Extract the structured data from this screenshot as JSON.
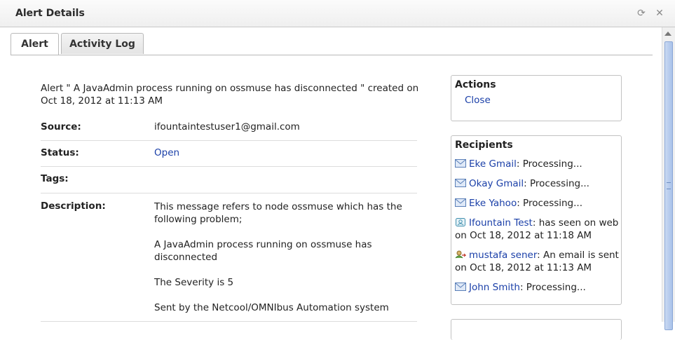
{
  "window": {
    "title": "Alert Details"
  },
  "tabs": [
    {
      "label": "Alert"
    },
    {
      "label": "Activity Log"
    }
  ],
  "alert": {
    "summary": "Alert \" A JavaAdmin process running on ossmuse has disconnected \" created on Oct 18, 2012 at 11:13 AM",
    "source_label": "Source:",
    "source_value": "ifountaintestuser1@gmail.com",
    "status_label": "Status:",
    "status_value": "Open",
    "tags_label": "Tags:",
    "tags_value": "",
    "description_label": "Description:",
    "description_lines": [
      "This message refers to node ossmuse which has the following problem;",
      "A JavaAdmin process running on ossmuse has disconnected",
      "The Severity is 5",
      "Sent by the Netcool/OMNIbus Automation system"
    ]
  },
  "actions": {
    "title": "Actions",
    "items": [
      {
        "label": "Close"
      }
    ]
  },
  "recipients": {
    "title": "Recipients",
    "items": [
      {
        "name": "Eke Gmail",
        "status": ": Processing...",
        "icon": "email-icon"
      },
      {
        "name": "Okay Gmail",
        "status": ": Processing...",
        "icon": "email-icon"
      },
      {
        "name": "Eke Yahoo",
        "status": ": Processing...",
        "icon": "email-icon"
      },
      {
        "name": "Ifountain Test",
        "status": ": has seen on web on Oct 18, 2012 at 11:18 AM",
        "icon": "web-seen-icon"
      },
      {
        "name": "mustafa sener",
        "status": ": An email is sent on Oct 18, 2012 at 11:13 AM",
        "icon": "email-sent-icon"
      },
      {
        "name": "John Smith",
        "status": ": Processing...",
        "icon": "email-icon"
      }
    ]
  },
  "colors": {
    "link": "#1a3fa8",
    "accent": "#a9c2ea"
  }
}
